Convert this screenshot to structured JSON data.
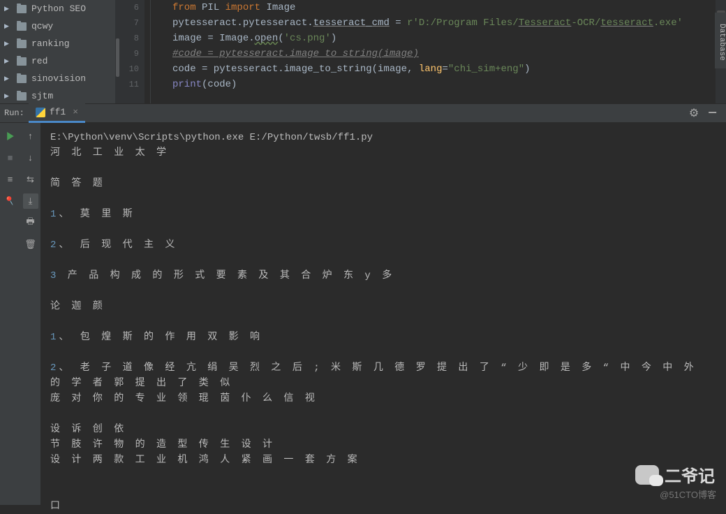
{
  "tree": {
    "items": [
      {
        "name": "Python SEO"
      },
      {
        "name": "qcwy"
      },
      {
        "name": "ranking"
      },
      {
        "name": "red"
      },
      {
        "name": "sinovision"
      },
      {
        "name": "sjtm"
      }
    ]
  },
  "editor": {
    "line_numbers": [
      "6",
      "7",
      "8",
      "9",
      "10",
      "11"
    ],
    "lines": {
      "l6_from": "from",
      "l6_pil": " PIL ",
      "l6_import": "import",
      "l6_image": " Image",
      "l7_a": "pytesseract.pytesseract.",
      "l7_b": "tesseract_cmd",
      "l7_eq": " = ",
      "l7_r": "r",
      "l7_str": "'D:/Program Files/",
      "l7_tes": "Tesseract",
      "l7_ocr": "-OCR/",
      "l7_tes2": "tesseract",
      "l7_exe": ".exe'",
      "l8_a": "image = Image.",
      "l8_open": "open",
      "l8_p": "(",
      "l8_str": "'cs.png'",
      "l8_c": ")",
      "l9": "#code = pytesseract.image_to_string(image)",
      "l10_a": "code = pytesseract.image_to_string(image",
      "l10_cm": ", ",
      "l10_lang": "lang",
      "l10_eq": "=",
      "l10_str": "\"chi_sim+eng\"",
      "l10_c": ")",
      "l11_print": "print",
      "l11_p": "(code)"
    }
  },
  "sidebar_db": "Database",
  "run": {
    "label": "Run:",
    "tab_name": "ff1",
    "close": "×",
    "gear_icon": "⚙",
    "minimize": "—"
  },
  "tool_icons": {
    "play": "▶",
    "stop": "■",
    "up": "↑",
    "down": "↓",
    "wrap": "⇄",
    "scroll": "⇲",
    "print": "⎙",
    "trash": "🗑",
    "pin": "📌",
    "help": "?"
  },
  "console": {
    "cmd": "E:\\Python\\venv\\Scripts\\python.exe E:/Python/twsb/ff1.py",
    "l1": "河 北 工 业 太 学",
    "l2": "简 答 题",
    "l3a": "1",
    "l3b": "、 莫 里 斯",
    "l4a": "2",
    "l4b": "、 后 现 代 主 义",
    "l5a": "3",
    "l5b": " 产 品 构 成 的 形 式 要 素 及 其 合 炉 东 y 多",
    "l6": "论 迦 颜",
    "l7a": "1",
    "l7b": "、 包 煌 斯 的 作 用 双 影 响",
    "l8a": "2",
    "l8b": "、 老 子 道 像 经 亢 绢 吴 烈 之 后 ; 米 斯 几 德 罗 提 出 了 “ 少 即 是 多 “ 中 今 中 外 的 学 者 郭 提 出 了 类 似",
    "l8c": "庞 对 你 的 专 业 领 琨 茵 仆 么 信 视",
    "l9": "设 诉 创 依",
    "l10": "节 肢 许 物 的 造 型 传 生 设 计",
    "l11": "设 计 两 款 工 业 机 鸿 人 紧 画 一 套 方 案",
    "l12": "口"
  },
  "watermark": {
    "text": "二爷记",
    "credit": "@51CTO博客"
  }
}
